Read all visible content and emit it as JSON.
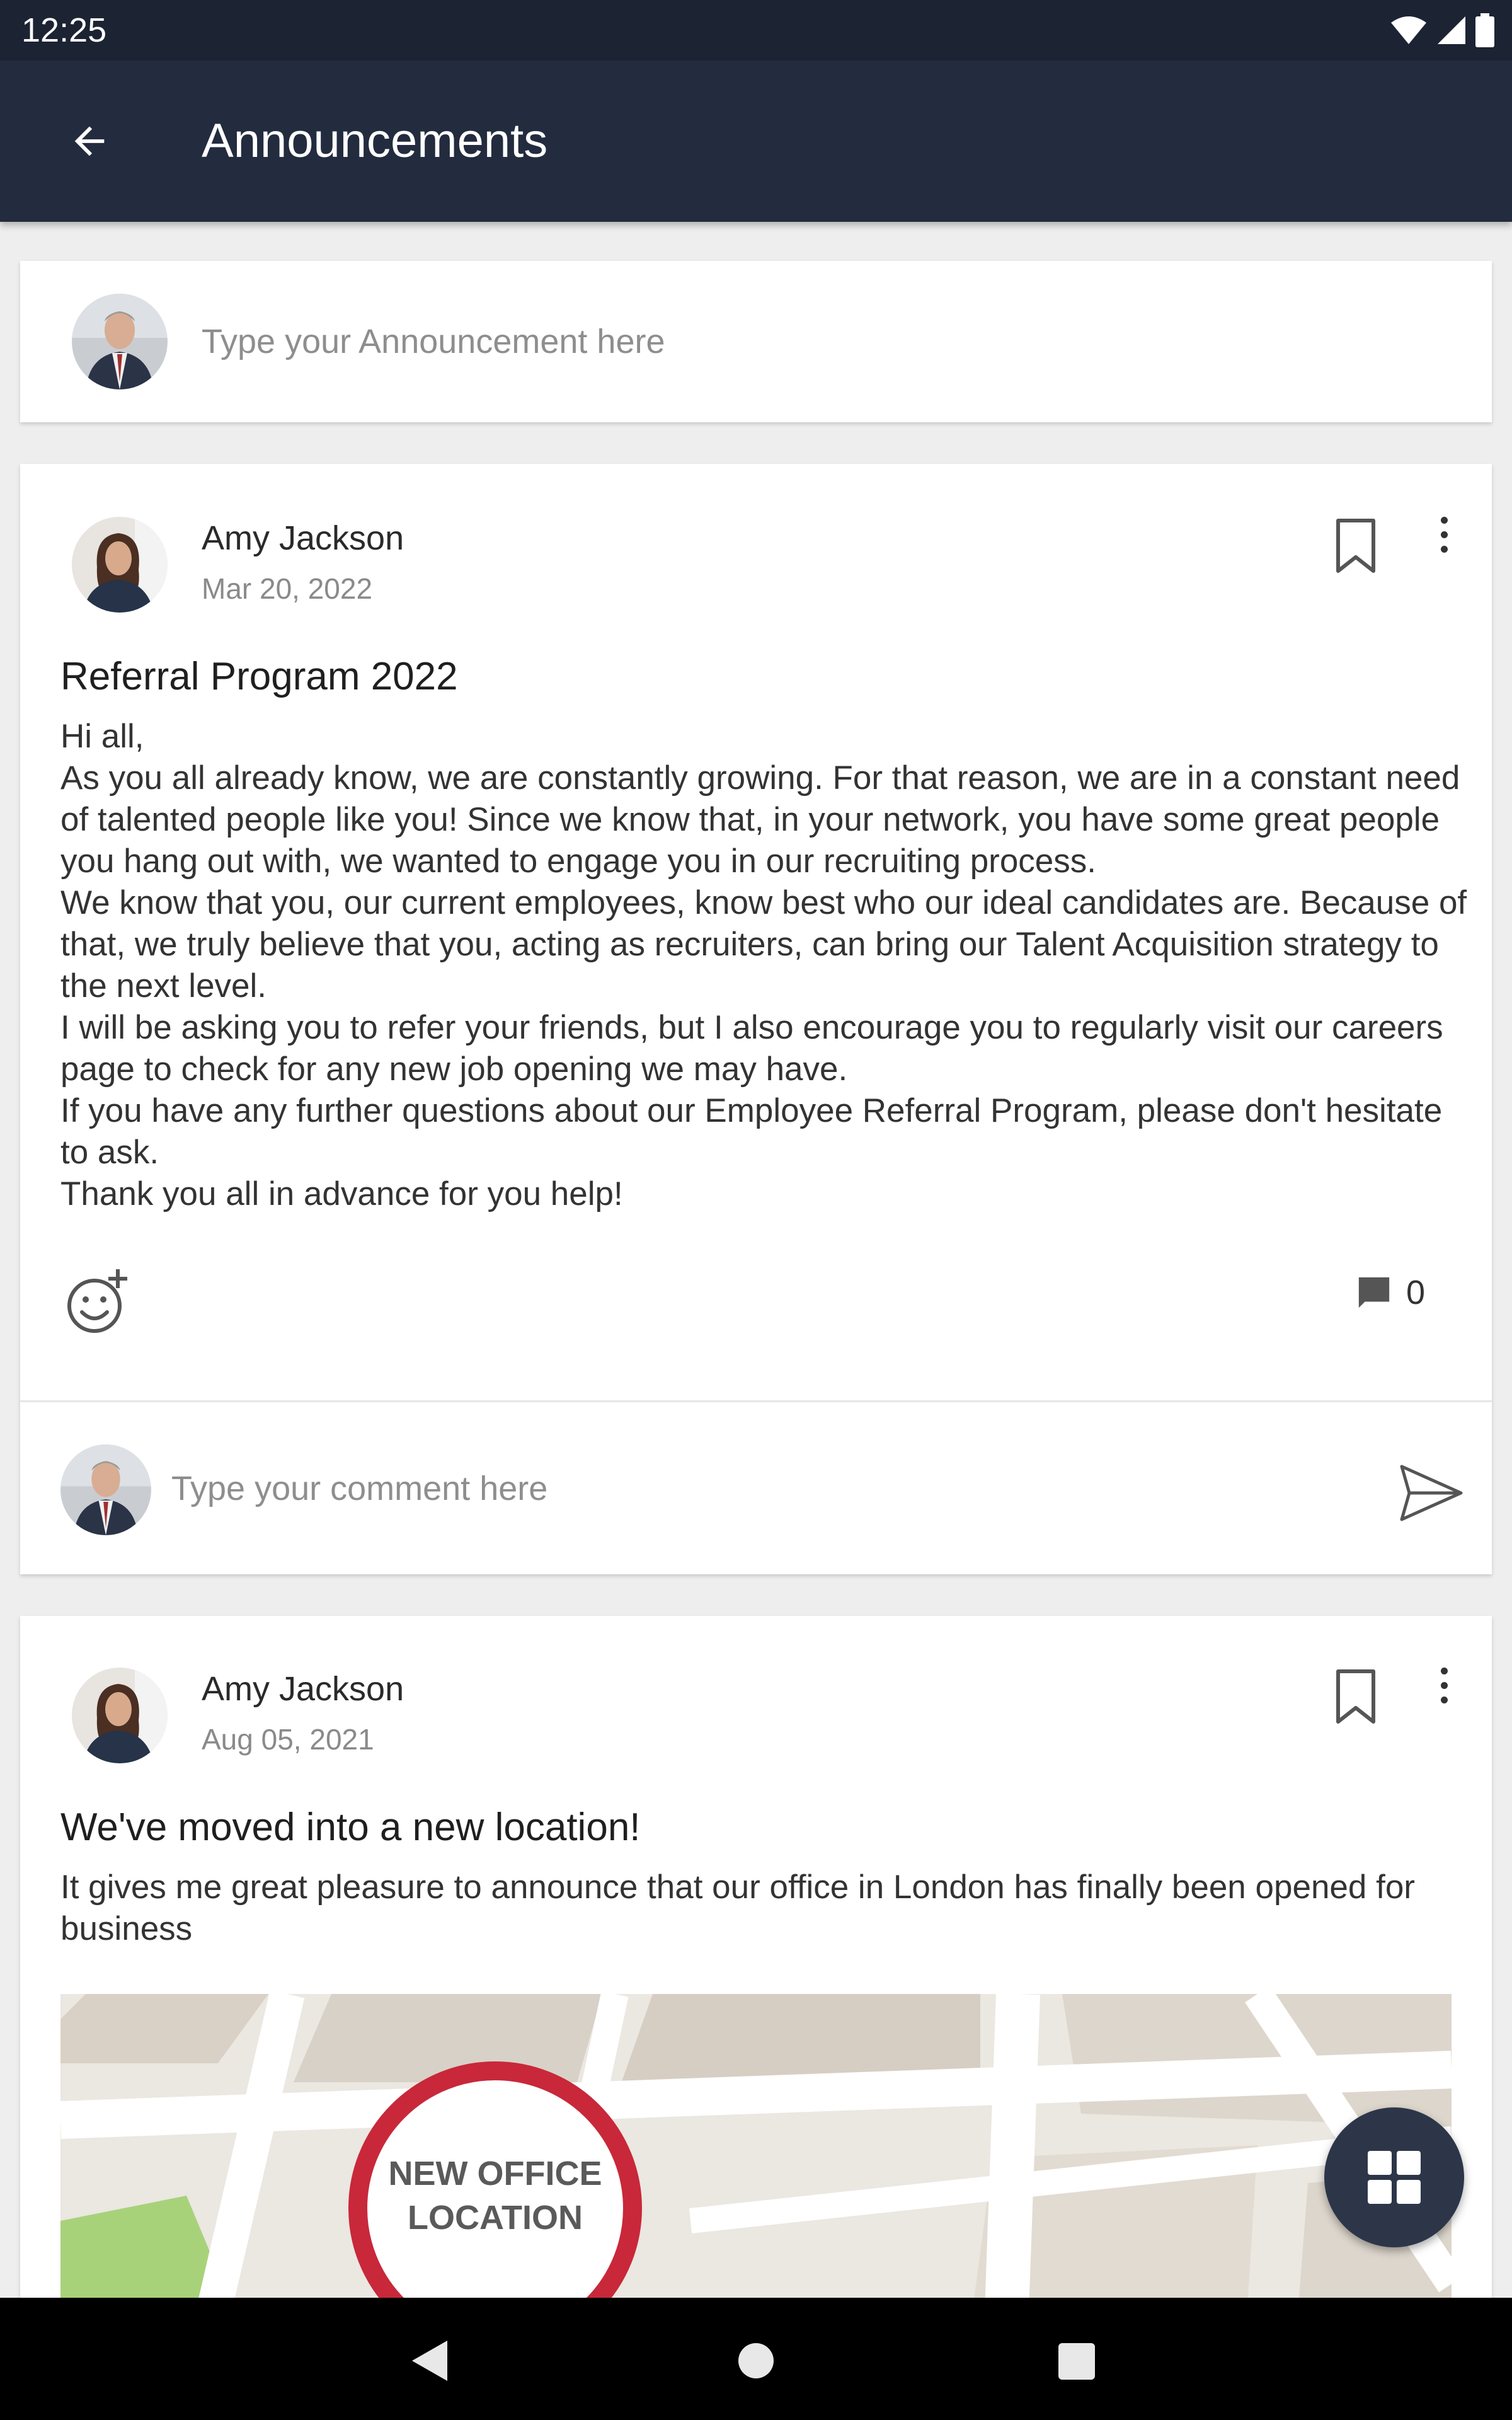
{
  "status_bar": {
    "time": "12:25"
  },
  "app_bar": {
    "title": "Announcements"
  },
  "composer": {
    "placeholder": "Type your Announcement here"
  },
  "posts": [
    {
      "author": "Amy Jackson",
      "date": "Mar 20, 2022",
      "title": "Referral Program 2022",
      "body": [
        "Hi all,",
        "As you all already know, we are constantly growing. For that reason, we are in a constant need of talented people like you! Since we know that, in your network, you have some great people you hang out with, we wanted to engage you in our recruiting process.",
        "We know that you, our current employees, know best who our ideal candidates are. Because of that, we truly believe that you, acting as recruiters, can bring our Talent Acquisition strategy to the next level.",
        "I will be asking you to refer your friends, but I also encourage you to regularly visit our careers page to check for any new job opening we may have.",
        "If you have any further questions about our Employee Referral Program, please don't hesitate to ask.",
        "Thank you all in advance for you help!"
      ],
      "comment_count": "0",
      "comment_placeholder": "Type your comment here"
    },
    {
      "author": "Amy Jackson",
      "date": "Aug 05, 2021",
      "title": "We've moved into a new location!",
      "body": [
        "It gives me great pleasure to announce that our office in London has finally been opened for business"
      ],
      "image_text": [
        "NEW OFFICE",
        "LOCATION"
      ]
    }
  ],
  "colors": {
    "header": "#232b3e",
    "status_bar": "#1c2333",
    "fab": "#2d3649",
    "map_ring": "#c8283a",
    "map_green": "#a8d27a"
  },
  "icons": {
    "back": "arrow-left-icon",
    "bookmark": "bookmark-outline-icon",
    "menu": "more-vert-icon",
    "reaction": "emoji-add-icon",
    "comment": "comment-icon",
    "send": "send-icon",
    "fab": "grid-apps-icon"
  }
}
